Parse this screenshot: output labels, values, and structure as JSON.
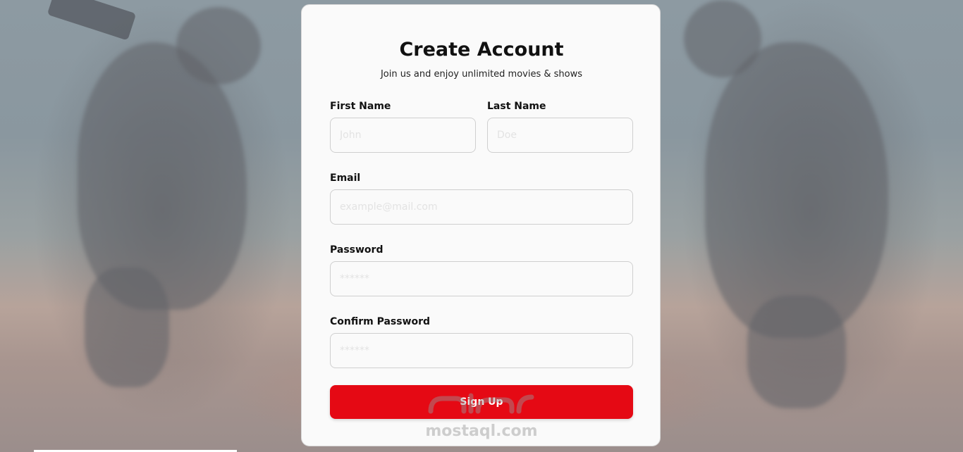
{
  "form": {
    "title": "Create Account",
    "subtitle": "Join us and enjoy unlimited movies & shows",
    "first_name": {
      "label": "First Name",
      "placeholder": "John"
    },
    "last_name": {
      "label": "Last Name",
      "placeholder": "Doe"
    },
    "email": {
      "label": "Email",
      "placeholder": "example@mail.com"
    },
    "password": {
      "label": "Password",
      "placeholder": "******"
    },
    "confirm_password": {
      "label": "Confirm Password",
      "placeholder": "******"
    },
    "submit_label": "Sign Up"
  },
  "watermark": {
    "text": "mostaql.com"
  },
  "colors": {
    "accent": "#e50914",
    "card_background": "#fafafa",
    "input_border": "#cfcfcf"
  }
}
